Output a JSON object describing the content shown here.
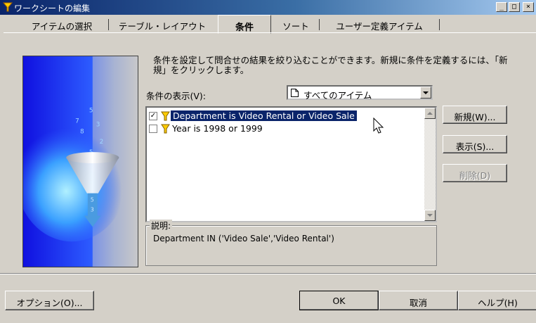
{
  "window": {
    "title": "ワークシートの編集",
    "controls": [
      "_",
      "□",
      "×"
    ]
  },
  "tabs": [
    {
      "label": "アイテムの選択",
      "active": false
    },
    {
      "label": "テーブル・レイアウト",
      "active": false
    },
    {
      "label": "条件",
      "active": true
    },
    {
      "label": "ソート",
      "active": false
    },
    {
      "label": "ユーザー定義アイテム",
      "active": false
    }
  ],
  "panel": {
    "description": "条件を設定して問合せの結果を絞り込むことができます。新規に条件を定義するには、「新規」をクリックします。",
    "filter_label": "条件の表示(V):",
    "filter_value": "すべてのアイテム",
    "conditions": [
      {
        "label": "Department is Video Rental or Video Sale",
        "checked": true,
        "selected": true
      },
      {
        "label": "Year is 1998 or 1999",
        "checked": false,
        "selected": false
      }
    ],
    "explanation_title": "説明:",
    "explanation_text": "Department IN ('Video Sale','Video Rental')"
  },
  "side_buttons": {
    "new": "新規(W)...",
    "show": "表示(S)...",
    "delete": "削除(D)"
  },
  "footer": {
    "options": "オプション(O)...",
    "ok": "OK",
    "cancel": "取消",
    "help": "ヘルプ(H)"
  },
  "colors": {
    "title_bar": "#0a246a",
    "selection": "#0a246a",
    "dialog_bg": "#d4d0c8",
    "illustration_blue": "#1a3cff"
  },
  "icons": [
    "app-icon",
    "funnel-icon",
    "document-icon",
    "dropdown-arrow-icon",
    "mouse-pointer-icon"
  ]
}
